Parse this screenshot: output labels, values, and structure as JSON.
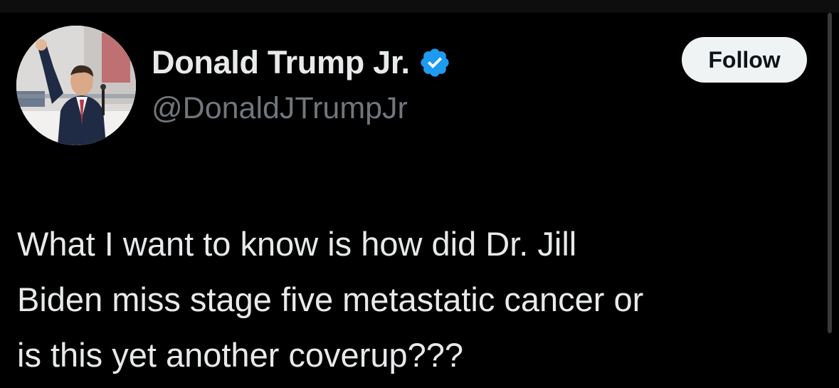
{
  "author": {
    "display_name": "Donald Trump Jr.",
    "handle": "@DonaldJTrumpJr",
    "verified_icon": "verified-badge-icon",
    "avatar": "profile-photo"
  },
  "actions": {
    "follow_label": "Follow"
  },
  "tweet": {
    "lines": [
      "What I want to know is how did Dr. Jill",
      "Biden miss stage five metastatic cancer or",
      "is this yet another coverup???"
    ]
  },
  "colors": {
    "background": "#000000",
    "text_primary": "#e7e9ea",
    "text_secondary": "#71767b",
    "verified_blue": "#1d9bf0",
    "follow_bg": "#eff3f4",
    "follow_text": "#0f1419"
  }
}
